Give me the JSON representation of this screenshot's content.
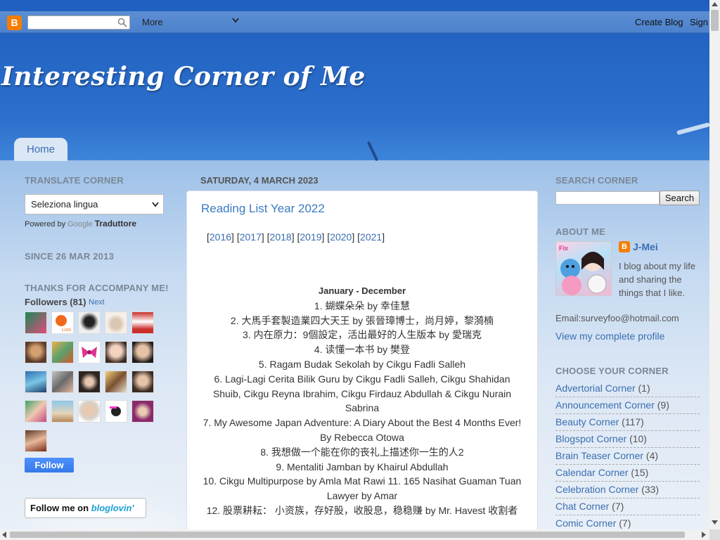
{
  "navbar": {
    "more_label": "More",
    "create_blog": "Create Blog",
    "sign_in": "Sign"
  },
  "header": {
    "blog_title": "Interesting Corner of Me",
    "home_tab": "Home"
  },
  "left_sidebar": {
    "translate_heading": "TRANSLATE CORNER",
    "language_select": "Seleziona lingua",
    "powered_by": "Powered by",
    "google": "Google",
    "traduttore": "Traduttore",
    "since_heading": "SINCE 26 MAR 2013",
    "thanks_heading": "THANKS FOR ACCOMPANY ME!",
    "followers_label": "Followers (81)",
    "followers_next": "Next",
    "follow_button": "Follow",
    "bloglovin_prefix": "Follow me on",
    "bloglovin_brand": "bloglovin'"
  },
  "post": {
    "date_header": "SATURDAY, 4 MARCH 2023",
    "title": "Reading List Year 2022",
    "year_links": [
      "2016",
      "2017",
      "2018",
      "2019",
      "2020",
      "2021"
    ],
    "month_range": "January - December",
    "entries": [
      "1.  蝴蝶朵朵 by 幸佳慧",
      "2. 大馬手套製造業四大天王 by 張晉璋博士，尚月婷，黎漪楠",
      "3. 内在原力：9個設定，活出最好的人生版本 by 愛瑞克",
      "4. 读懂一本书 by 樊登",
      "5. Ragam Budak Sekolah by Cikgu Fadli Salleh",
      "6. Lagi-Lagi Cerita Bilik Guru by Cikgu Fadli Salleh, Cikgu Shahidan Shuib, Cikgu Reyna Ibrahim, Cikgu Firdauz Abdullah & Cikgu Nurain Sabrina",
      "7. My Awesome Japan Adventure: A Diary About the Best 4 Months Ever! By Rebecca Otowa",
      "8. 我想做一个能在你的丧礼上描述你一生的人2",
      "9. Mentaliti Jamban by Khairul Abdullah",
      "10. Cikgu Multipurpose by Amla Mat Rawi 11. 165 Nasihat Guaman Tuan Lawyer by Amar",
      "12. 股票耕耘： 小资族，存好股，收股息，稳稳赚 by Mr. Havest 收割者"
    ]
  },
  "right_sidebar": {
    "search_heading": "SEARCH CORNER",
    "search_button": "Search",
    "about_heading": "ABOUT ME",
    "profile_name": "J-Mei",
    "profile_desc": "I blog about my life and sharing the things that I like.",
    "profile_email": "Email:surveyfoo@hotmail.com",
    "profile_link": "View my complete profile",
    "choose_heading": "CHOOSE YOUR CORNER",
    "corners": [
      {
        "label": "Advertorial Corner",
        "count": "(1)"
      },
      {
        "label": "Announcement Corner",
        "count": "(9)"
      },
      {
        "label": "Beauty Corner",
        "count": "(117)"
      },
      {
        "label": "Blogspot Corner",
        "count": "(10)"
      },
      {
        "label": "Brain Teaser Corner",
        "count": "(4)"
      },
      {
        "label": "Calendar Corner",
        "count": "(15)"
      },
      {
        "label": "Celebration Corner",
        "count": "(33)"
      },
      {
        "label": "Chat Corner",
        "count": "(7)"
      },
      {
        "label": "Comic Corner",
        "count": "(7)"
      }
    ]
  },
  "colors": {
    "link": "#3a6eb0",
    "heading": "#7a8796",
    "blogger_orange": "#f57d00",
    "follow_blue": "#4d90fe"
  },
  "icons": {
    "blogger": "blogger-logo-icon",
    "search": "magnifier-icon",
    "dropdown": "chevron-down-icon"
  }
}
